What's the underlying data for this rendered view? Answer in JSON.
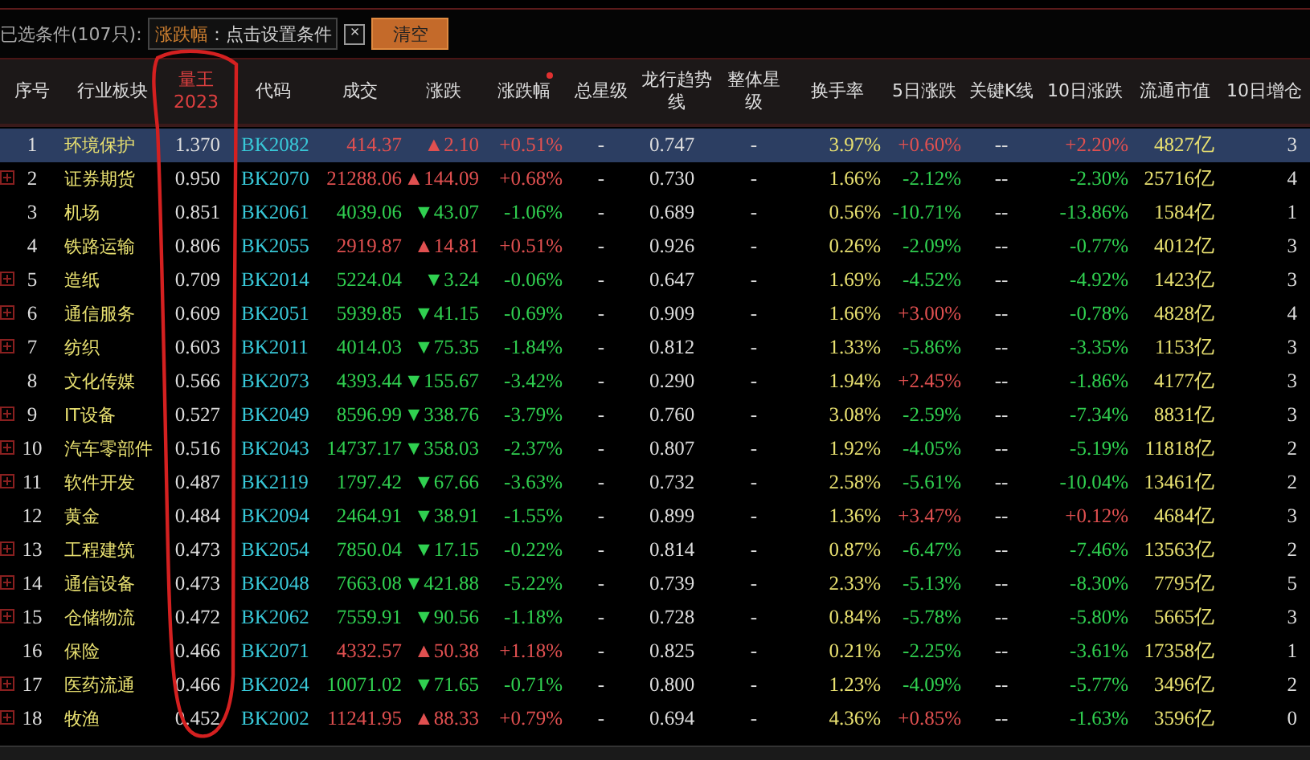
{
  "filter_bar": {
    "label": "已选条件(107只):",
    "chip_key": "涨跌幅",
    "chip_text": "：点击设置条件",
    "chip_close": "×",
    "clear_button": "清空"
  },
  "columns": [
    {
      "label": "序号",
      "highlight": false,
      "sorted": false
    },
    {
      "label": "行业板块",
      "highlight": false,
      "sorted": false
    },
    {
      "label": "量王2023",
      "highlight": true,
      "sorted": false
    },
    {
      "label": "代码",
      "highlight": false,
      "sorted": false
    },
    {
      "label": "成交",
      "highlight": false,
      "sorted": false
    },
    {
      "label": "涨跌",
      "highlight": false,
      "sorted": false
    },
    {
      "label": "涨跌幅",
      "highlight": false,
      "sorted": true
    },
    {
      "label": "总星级",
      "highlight": false,
      "sorted": false
    },
    {
      "label": "龙行趋势线",
      "highlight": false,
      "sorted": false
    },
    {
      "label": "整体星级",
      "highlight": false,
      "sorted": false
    },
    {
      "label": "换手率",
      "highlight": false,
      "sorted": false
    },
    {
      "label": "5日涨跌",
      "highlight": false,
      "sorted": false
    },
    {
      "label": "关键K线",
      "highlight": false,
      "sorted": false
    },
    {
      "label": "10日涨跌",
      "highlight": false,
      "sorted": false
    },
    {
      "label": "流通市值",
      "highlight": false,
      "sorted": false
    },
    {
      "label": "10日增仓",
      "highlight": false,
      "sorted": false
    }
  ],
  "rows": [
    {
      "seq": "1",
      "name": "环境保护",
      "lw": "1.370",
      "code": "BK2082",
      "price": "414.37",
      "change": "▲2.10",
      "pct": "+0.51%",
      "up": true,
      "total_star": "-",
      "trend_line": "0.747",
      "overall_star": "-",
      "turnover": "3.97%",
      "d5": "+0.60%",
      "d5_up": true,
      "k_line": "--",
      "d10": "+2.20%",
      "d10_up": true,
      "mcap": "4827亿",
      "add10": "3",
      "expandable": false,
      "selected": true
    },
    {
      "seq": "2",
      "name": "证券期货",
      "lw": "0.950",
      "code": "BK2070",
      "price": "21288.06",
      "change": "▲144.09",
      "pct": "+0.68%",
      "up": true,
      "total_star": "-",
      "trend_line": "0.730",
      "overall_star": "-",
      "turnover": "1.66%",
      "d5": "-2.12%",
      "d5_up": false,
      "k_line": "--",
      "d10": "-2.30%",
      "d10_up": false,
      "mcap": "25716亿",
      "add10": "4",
      "expandable": true,
      "selected": false
    },
    {
      "seq": "3",
      "name": "机场",
      "lw": "0.851",
      "code": "BK2061",
      "price": "4039.06",
      "change": "▼43.07",
      "pct": "-1.06%",
      "up": false,
      "total_star": "-",
      "trend_line": "0.689",
      "overall_star": "-",
      "turnover": "0.56%",
      "d5": "-10.71%",
      "d5_up": false,
      "k_line": "--",
      "d10": "-13.86%",
      "d10_up": false,
      "mcap": "1584亿",
      "add10": "1",
      "expandable": false,
      "selected": false
    },
    {
      "seq": "4",
      "name": "铁路运输",
      "lw": "0.806",
      "code": "BK2055",
      "price": "2919.87",
      "change": "▲14.81",
      "pct": "+0.51%",
      "up": true,
      "total_star": "-",
      "trend_line": "0.926",
      "overall_star": "-",
      "turnover": "0.26%",
      "d5": "-2.09%",
      "d5_up": false,
      "k_line": "--",
      "d10": "-0.77%",
      "d10_up": false,
      "mcap": "4012亿",
      "add10": "3",
      "expandable": false,
      "selected": false
    },
    {
      "seq": "5",
      "name": "造纸",
      "lw": "0.709",
      "code": "BK2014",
      "price": "5224.04",
      "change": "▼3.24",
      "pct": "-0.06%",
      "up": false,
      "total_star": "-",
      "trend_line": "0.647",
      "overall_star": "-",
      "turnover": "1.69%",
      "d5": "-4.52%",
      "d5_up": false,
      "k_line": "--",
      "d10": "-4.92%",
      "d10_up": false,
      "mcap": "1423亿",
      "add10": "3",
      "expandable": true,
      "selected": false
    },
    {
      "seq": "6",
      "name": "通信服务",
      "lw": "0.609",
      "code": "BK2051",
      "price": "5939.85",
      "change": "▼41.15",
      "pct": "-0.69%",
      "up": false,
      "total_star": "-",
      "trend_line": "0.909",
      "overall_star": "-",
      "turnover": "1.66%",
      "d5": "+3.00%",
      "d5_up": true,
      "k_line": "--",
      "d10": "-0.78%",
      "d10_up": false,
      "mcap": "4828亿",
      "add10": "4",
      "expandable": true,
      "selected": false
    },
    {
      "seq": "7",
      "name": "纺织",
      "lw": "0.603",
      "code": "BK2011",
      "price": "4014.03",
      "change": "▼75.35",
      "pct": "-1.84%",
      "up": false,
      "total_star": "-",
      "trend_line": "0.812",
      "overall_star": "-",
      "turnover": "1.33%",
      "d5": "-5.86%",
      "d5_up": false,
      "k_line": "--",
      "d10": "-3.35%",
      "d10_up": false,
      "mcap": "1153亿",
      "add10": "3",
      "expandable": true,
      "selected": false
    },
    {
      "seq": "8",
      "name": "文化传媒",
      "lw": "0.566",
      "code": "BK2073",
      "price": "4393.44",
      "change": "▼155.67",
      "pct": "-3.42%",
      "up": false,
      "total_star": "-",
      "trend_line": "0.290",
      "overall_star": "-",
      "turnover": "1.94%",
      "d5": "+2.45%",
      "d5_up": true,
      "k_line": "--",
      "d10": "-1.86%",
      "d10_up": false,
      "mcap": "4177亿",
      "add10": "3",
      "expandable": false,
      "selected": false
    },
    {
      "seq": "9",
      "name": "IT设备",
      "lw": "0.527",
      "code": "BK2049",
      "price": "8596.99",
      "change": "▼338.76",
      "pct": "-3.79%",
      "up": false,
      "total_star": "-",
      "trend_line": "0.760",
      "overall_star": "-",
      "turnover": "3.08%",
      "d5": "-2.59%",
      "d5_up": false,
      "k_line": "--",
      "d10": "-7.34%",
      "d10_up": false,
      "mcap": "8831亿",
      "add10": "3",
      "expandable": true,
      "selected": false
    },
    {
      "seq": "10",
      "name": "汽车零部件",
      "lw": "0.516",
      "code": "BK2043",
      "price": "14737.17",
      "change": "▼358.03",
      "pct": "-2.37%",
      "up": false,
      "total_star": "-",
      "trend_line": "0.807",
      "overall_star": "-",
      "turnover": "1.92%",
      "d5": "-4.05%",
      "d5_up": false,
      "k_line": "--",
      "d10": "-5.19%",
      "d10_up": false,
      "mcap": "11818亿",
      "add10": "2",
      "expandable": true,
      "selected": false
    },
    {
      "seq": "11",
      "name": "软件开发",
      "lw": "0.487",
      "code": "BK2119",
      "price": "1797.42",
      "change": "▼67.66",
      "pct": "-3.63%",
      "up": false,
      "total_star": "-",
      "trend_line": "0.732",
      "overall_star": "-",
      "turnover": "2.58%",
      "d5": "-5.61%",
      "d5_up": false,
      "k_line": "--",
      "d10": "-10.04%",
      "d10_up": false,
      "mcap": "13461亿",
      "add10": "2",
      "expandable": true,
      "selected": false
    },
    {
      "seq": "12",
      "name": "黄金",
      "lw": "0.484",
      "code": "BK2094",
      "price": "2464.91",
      "change": "▼38.91",
      "pct": "-1.55%",
      "up": false,
      "total_star": "-",
      "trend_line": "0.899",
      "overall_star": "-",
      "turnover": "1.36%",
      "d5": "+3.47%",
      "d5_up": true,
      "k_line": "--",
      "d10": "+0.12%",
      "d10_up": true,
      "mcap": "4684亿",
      "add10": "3",
      "expandable": false,
      "selected": false
    },
    {
      "seq": "13",
      "name": "工程建筑",
      "lw": "0.473",
      "code": "BK2054",
      "price": "7850.04",
      "change": "▼17.15",
      "pct": "-0.22%",
      "up": false,
      "total_star": "-",
      "trend_line": "0.814",
      "overall_star": "-",
      "turnover": "0.87%",
      "d5": "-6.47%",
      "d5_up": false,
      "k_line": "--",
      "d10": "-7.46%",
      "d10_up": false,
      "mcap": "13563亿",
      "add10": "2",
      "expandable": true,
      "selected": false
    },
    {
      "seq": "14",
      "name": "通信设备",
      "lw": "0.473",
      "code": "BK2048",
      "price": "7663.08",
      "change": "▼421.88",
      "pct": "-5.22%",
      "up": false,
      "total_star": "-",
      "trend_line": "0.739",
      "overall_star": "-",
      "turnover": "2.33%",
      "d5": "-5.13%",
      "d5_up": false,
      "k_line": "--",
      "d10": "-8.30%",
      "d10_up": false,
      "mcap": "7795亿",
      "add10": "5",
      "expandable": true,
      "selected": false
    },
    {
      "seq": "15",
      "name": "仓储物流",
      "lw": "0.472",
      "code": "BK2062",
      "price": "7559.91",
      "change": "▼90.56",
      "pct": "-1.18%",
      "up": false,
      "total_star": "-",
      "trend_line": "0.728",
      "overall_star": "-",
      "turnover": "0.84%",
      "d5": "-5.78%",
      "d5_up": false,
      "k_line": "--",
      "d10": "-5.80%",
      "d10_up": false,
      "mcap": "5665亿",
      "add10": "3",
      "expandable": true,
      "selected": false
    },
    {
      "seq": "16",
      "name": "保险",
      "lw": "0.466",
      "code": "BK2071",
      "price": "4332.57",
      "change": "▲50.38",
      "pct": "+1.18%",
      "up": true,
      "total_star": "-",
      "trend_line": "0.825",
      "overall_star": "-",
      "turnover": "0.21%",
      "d5": "-2.25%",
      "d5_up": false,
      "k_line": "--",
      "d10": "-3.61%",
      "d10_up": false,
      "mcap": "17358亿",
      "add10": "1",
      "expandable": false,
      "selected": false
    },
    {
      "seq": "17",
      "name": "医药流通",
      "lw": "0.466",
      "code": "BK2024",
      "price": "10071.02",
      "change": "▼71.65",
      "pct": "-0.71%",
      "up": false,
      "total_star": "-",
      "trend_line": "0.800",
      "overall_star": "-",
      "turnover": "1.23%",
      "d5": "-4.09%",
      "d5_up": false,
      "k_line": "--",
      "d10": "-5.77%",
      "d10_up": false,
      "mcap": "3496亿",
      "add10": "2",
      "expandable": true,
      "selected": false
    },
    {
      "seq": "18",
      "name": "牧渔",
      "lw": "0.452",
      "code": "BK2002",
      "price": "11241.95",
      "change": "▲88.33",
      "pct": "+0.79%",
      "up": true,
      "total_star": "-",
      "trend_line": "0.694",
      "overall_star": "-",
      "turnover": "4.36%",
      "d5": "+0.85%",
      "d5_up": true,
      "k_line": "--",
      "d10": "-1.63%",
      "d10_up": false,
      "mcap": "3596亿",
      "add10": "0",
      "expandable": true,
      "selected": false
    }
  ]
}
